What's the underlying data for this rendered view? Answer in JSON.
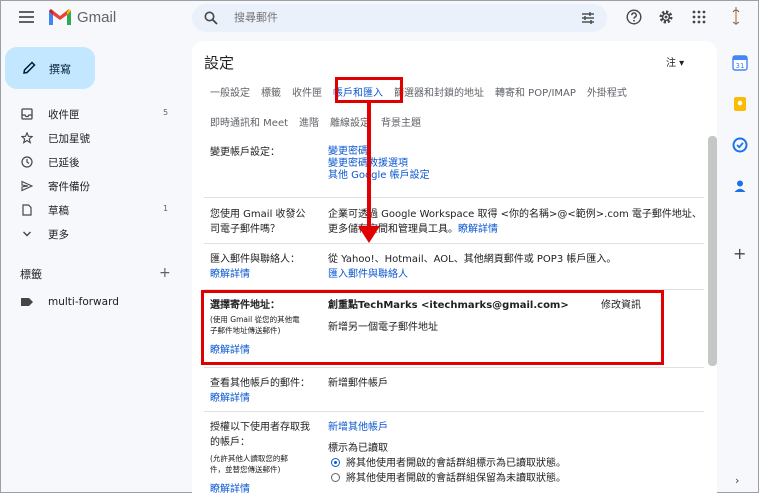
{
  "app": {
    "name": "Gmail"
  },
  "search": {
    "placeholder": "搜尋郵件"
  },
  "compose": {
    "label": "撰寫"
  },
  "nav": {
    "items": [
      {
        "label": "收件匣",
        "count": "5",
        "icon": "inbox-icon"
      },
      {
        "label": "已加星號",
        "count": "",
        "icon": "star-icon"
      },
      {
        "label": "已延後",
        "count": "",
        "icon": "clock-icon"
      },
      {
        "label": "寄件備份",
        "count": "",
        "icon": "send-icon"
      },
      {
        "label": "草稿",
        "count": "1",
        "icon": "draft-icon"
      },
      {
        "label": "更多",
        "count": "",
        "icon": "chevron-down-icon"
      }
    ],
    "labels_heading": "標籤",
    "labels_add": "+",
    "labels": [
      {
        "name": "multi-forward"
      }
    ]
  },
  "settings": {
    "title": "設定",
    "language_short": "注",
    "tabs_row1": [
      "一般設定",
      "標籤",
      "收件匣",
      "帳戶和匯入",
      "篩選器和封鎖的地址",
      "轉寄和 POP/IMAP",
      "外掛程式"
    ],
    "tabs_row2": [
      "即時通訊和 Meet",
      "進階",
      "離線設定",
      "背景主題"
    ],
    "active_tab": "帳戶和匯入",
    "rows": {
      "change_account": {
        "label": "變更帳戶設定：",
        "links": [
          "變更密碼",
          "變更密碼救援選項",
          "其他 Google 帳戶設定"
        ]
      },
      "workspace": {
        "label_line1": "您使用 Gmail 收發公",
        "label_line2": "司電子郵件嗎？",
        "text_line1": "企業可透過 Google Workspace 取得 <你的名稱>@<範例>.com 電子郵件地址、",
        "text_line2": "更多儲存空間和管理員工具。",
        "learn_more": "瞭解詳情"
      },
      "import": {
        "label": "匯入郵件與聯絡人：",
        "learn_more": "瞭解詳情",
        "text": "從 Yahoo!、Hotmail、AOL、其他網頁郵件或 POP3 帳戶匯入。",
        "link": "匯入郵件與聯絡人"
      },
      "send_as": {
        "label": "選擇寄件地址：",
        "sub_line1": "(使用 Gmail 從您的其他電",
        "sub_line2": "子郵件地址傳送郵件)",
        "learn_more": "瞭解詳情",
        "address": "創重點TechMarks <itechmarks@gmail.com>",
        "edit": "修改資訊",
        "add_link": "新增另一個電子郵件地址"
      },
      "check_mail": {
        "label": "查看其他帳戶的郵件：",
        "learn_more": "瞭解詳情",
        "link": "新增郵件帳戶"
      },
      "grant_access": {
        "label_line1": "授權以下使用者存取我",
        "label_line2": "的帳戶：",
        "sub_line1": "(允許其他人讀取您的郵",
        "sub_line2": "件，並替您傳送郵件)",
        "learn_more": "瞭解詳情",
        "link": "新增其他帳戶",
        "mark_read_heading": "標示為已讀取",
        "option1": "將其他使用者開啟的會話群組標示為已讀取狀態。",
        "option2": "將其他使用者開啟的會話群組保留為未讀取狀態。"
      }
    }
  },
  "colors": {
    "highlight": "#e00000",
    "link": "#0b57d0",
    "compose_bg": "#c2e7ff"
  }
}
